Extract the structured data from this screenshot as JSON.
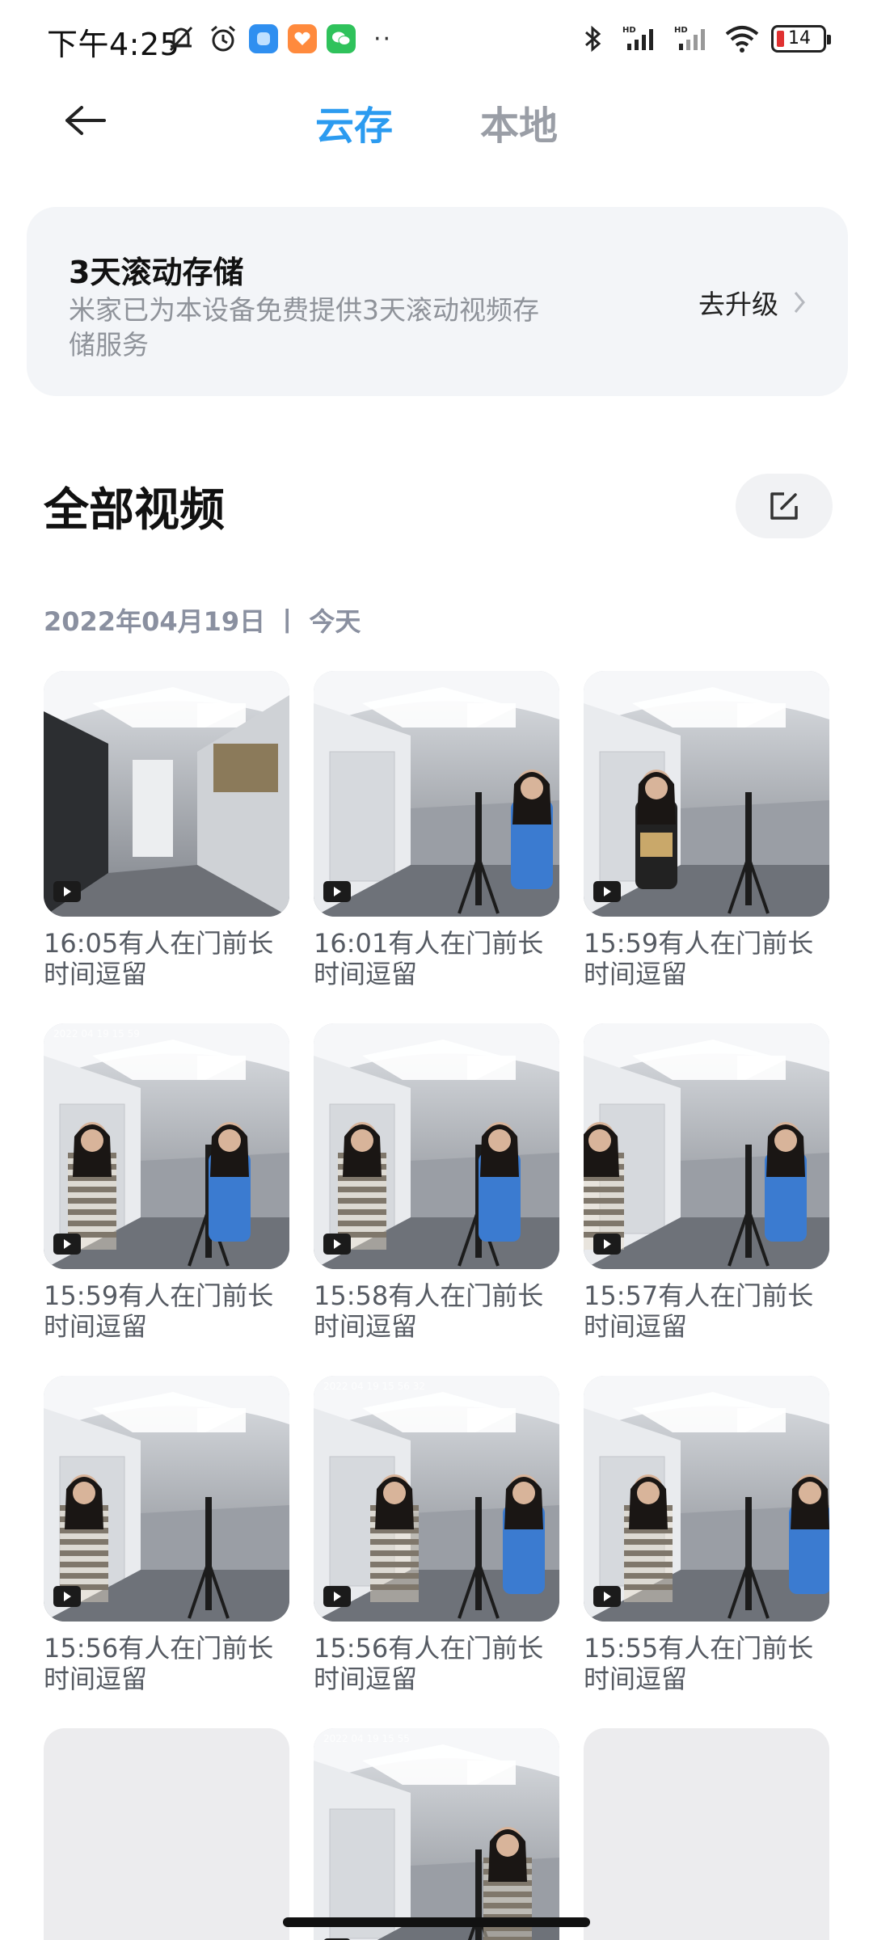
{
  "status_bar": {
    "time": "下午4:25",
    "battery": "14",
    "icons": [
      "mute-bell-icon",
      "alarm-icon",
      "app-blue-icon",
      "app-orange-icon",
      "wechat-icon",
      "more-dots-icon",
      "bluetooth-icon",
      "signal-hd-icon",
      "signal-hd-icon",
      "wifi-icon",
      "battery-icon"
    ],
    "more_dots": "··",
    "hd_label": "HD"
  },
  "header": {
    "tabs": [
      {
        "label": "云存",
        "active": true
      },
      {
        "label": "本地",
        "active": false
      }
    ],
    "accent_color": "#2b9bf0"
  },
  "banner": {
    "title": "3天滚动存储",
    "description": "米家已为本设备免费提供3天滚动视频存储服务",
    "action_label": "去升级"
  },
  "section": {
    "title": "全部视频",
    "date_label": "2022年04月19日 丨 今天"
  },
  "videos": [
    {
      "caption": "16:05有人在门前长时间逗留",
      "scene": "hall"
    },
    {
      "caption": "16:01有人在门前长时间逗留",
      "scene": "office1"
    },
    {
      "caption": "15:59有人在门前长时间逗留",
      "scene": "office2"
    },
    {
      "caption": "15:59有人在门前长时间逗留",
      "scene": "office3",
      "watermark": "2022 04 19 15 59"
    },
    {
      "caption": "15:58有人在门前长时间逗留",
      "scene": "office3"
    },
    {
      "caption": "15:57有人在门前长时间逗留",
      "scene": "office4"
    },
    {
      "caption": "15:56有人在门前长时间逗留",
      "scene": "office5"
    },
    {
      "caption": "15:56有人在门前长时间逗留",
      "scene": "office6",
      "watermark": "2022 04 19 15 56 32"
    },
    {
      "caption": "15:55有人在门前长时间逗留",
      "scene": "office7"
    },
    {
      "caption": "",
      "scene": "empty"
    },
    {
      "caption": "",
      "scene": "office8",
      "watermark": "2022 04 19 15 55"
    },
    {
      "caption": "",
      "scene": "empty"
    }
  ]
}
